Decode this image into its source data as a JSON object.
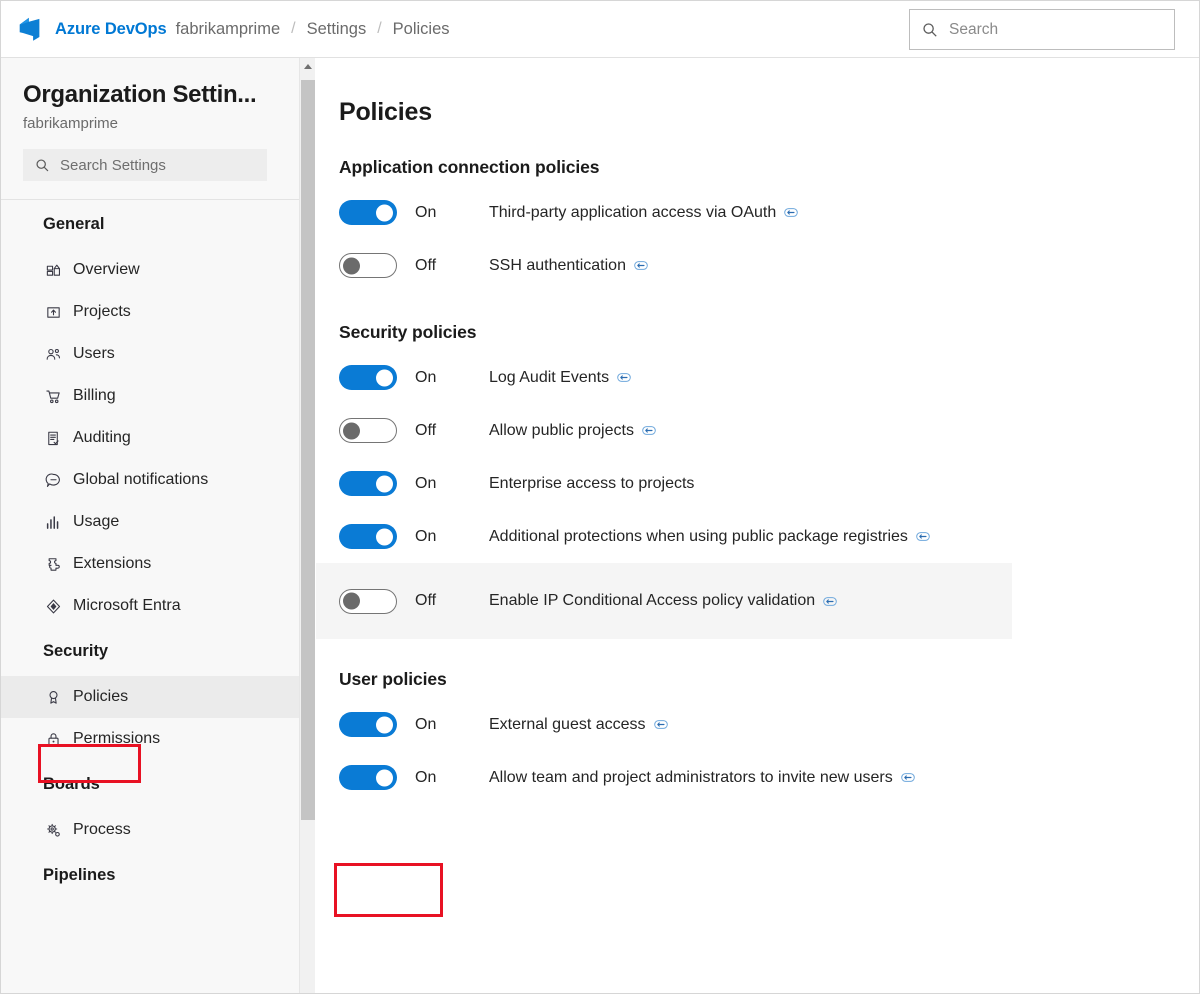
{
  "header": {
    "brand": "Azure DevOps",
    "breadcrumb": [
      "fabrikamprime",
      "Settings",
      "Policies"
    ],
    "separator": "/",
    "search_placeholder": "Search",
    "search_value": "",
    "logo_icon": "azure-devops-logo",
    "search_icon": "search-icon"
  },
  "sidebar": {
    "title": "Organization Settin...",
    "subtitle": "fabrikamprime",
    "search_placeholder": "Search Settings",
    "search_value": "",
    "search_icon": "search-icon",
    "groups": [
      {
        "label": "General",
        "items": [
          {
            "label": "Overview",
            "icon": "overview-grid-icon",
            "selected": false
          },
          {
            "label": "Projects",
            "icon": "project-box-icon",
            "selected": false
          },
          {
            "label": "Users",
            "icon": "users-icon",
            "selected": false
          },
          {
            "label": "Billing",
            "icon": "shopping-cart-icon",
            "selected": false
          },
          {
            "label": "Auditing",
            "icon": "audit-log-icon",
            "selected": false
          },
          {
            "label": "Global notifications",
            "icon": "notification-bubble-icon",
            "selected": false
          },
          {
            "label": "Usage",
            "icon": "bar-chart-icon",
            "selected": false
          },
          {
            "label": "Extensions",
            "icon": "puzzle-extension-icon",
            "selected": false
          },
          {
            "label": "Microsoft Entra",
            "icon": "microsoft-entra-icon",
            "selected": false
          }
        ]
      },
      {
        "label": "Security",
        "items": [
          {
            "label": "Policies",
            "icon": "policy-ribbon-icon",
            "selected": true
          },
          {
            "label": "Permissions",
            "icon": "lock-icon",
            "selected": false
          }
        ]
      },
      {
        "label": "Boards",
        "items": [
          {
            "label": "Process",
            "icon": "process-gear-icon",
            "selected": false
          }
        ]
      },
      {
        "label": "Pipelines",
        "items": []
      }
    ],
    "scrollbar": {
      "up_arrow_icon": "chevron-up-icon"
    }
  },
  "main": {
    "page_title": "Policies",
    "sections": [
      {
        "title": "Application connection policies",
        "policies": [
          {
            "state": "On",
            "on": true,
            "name": "Third-party application access via OAuth",
            "has_link": true,
            "hovered": false
          },
          {
            "state": "Off",
            "on": false,
            "name": "SSH authentication",
            "has_link": true,
            "hovered": false
          }
        ]
      },
      {
        "title": "Security policies",
        "policies": [
          {
            "state": "On",
            "on": true,
            "name": "Log Audit Events",
            "has_link": true,
            "hovered": false
          },
          {
            "state": "Off",
            "on": false,
            "name": "Allow public projects",
            "has_link": true,
            "hovered": false
          },
          {
            "state": "On",
            "on": true,
            "name": "Enterprise access to projects",
            "has_link": false,
            "hovered": false
          },
          {
            "state": "On",
            "on": true,
            "name": "Additional protections when using public package registries",
            "has_link": true,
            "hovered": false
          },
          {
            "state": "Off",
            "on": false,
            "name": "Enable IP Conditional Access policy validation",
            "has_link": true,
            "hovered": true
          }
        ]
      },
      {
        "title": "User policies",
        "policies": [
          {
            "state": "On",
            "on": true,
            "name": "External guest access",
            "has_link": true,
            "hovered": false
          },
          {
            "state": "On",
            "on": true,
            "name": "Allow team and project administrators to invite new users",
            "has_link": true,
            "hovered": false
          }
        ]
      }
    ],
    "link_icon": "external-link-icon"
  },
  "annotations": [
    {
      "name": "policies-sidebar-highlight",
      "color": "#e81123"
    },
    {
      "name": "external-guest-access-toggle-highlight",
      "color": "#e81123"
    }
  ],
  "colors": {
    "brand_blue": "#0078d4",
    "toggle_on": "#0a7bd5",
    "annotation_red": "#e81123",
    "sidebar_bg": "#f8f8f8",
    "row_hover": "#f5f5f5"
  }
}
